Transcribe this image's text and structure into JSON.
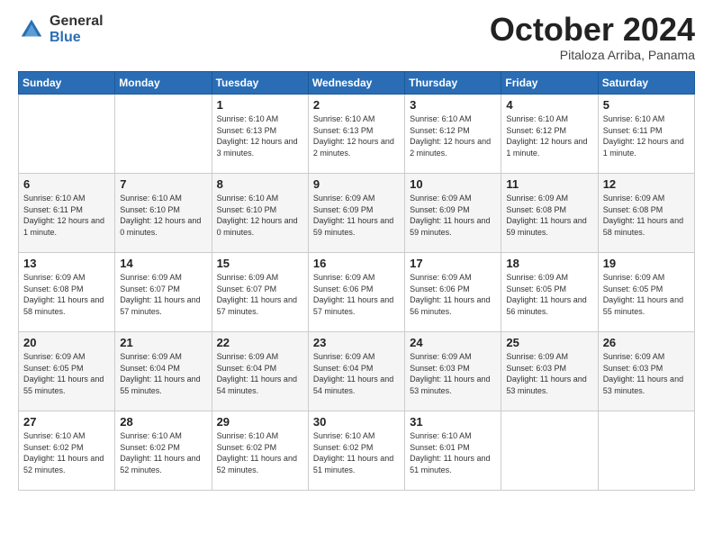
{
  "logo": {
    "general": "General",
    "blue": "Blue"
  },
  "title": "October 2024",
  "subtitle": "Pitaloza Arriba, Panama",
  "weekdays": [
    "Sunday",
    "Monday",
    "Tuesday",
    "Wednesday",
    "Thursday",
    "Friday",
    "Saturday"
  ],
  "weeks": [
    [
      {
        "day": "",
        "info": ""
      },
      {
        "day": "",
        "info": ""
      },
      {
        "day": "1",
        "info": "Sunrise: 6:10 AM\nSunset: 6:13 PM\nDaylight: 12 hours and 3 minutes."
      },
      {
        "day": "2",
        "info": "Sunrise: 6:10 AM\nSunset: 6:13 PM\nDaylight: 12 hours and 2 minutes."
      },
      {
        "day": "3",
        "info": "Sunrise: 6:10 AM\nSunset: 6:12 PM\nDaylight: 12 hours and 2 minutes."
      },
      {
        "day": "4",
        "info": "Sunrise: 6:10 AM\nSunset: 6:12 PM\nDaylight: 12 hours and 1 minute."
      },
      {
        "day": "5",
        "info": "Sunrise: 6:10 AM\nSunset: 6:11 PM\nDaylight: 12 hours and 1 minute."
      }
    ],
    [
      {
        "day": "6",
        "info": "Sunrise: 6:10 AM\nSunset: 6:11 PM\nDaylight: 12 hours and 1 minute."
      },
      {
        "day": "7",
        "info": "Sunrise: 6:10 AM\nSunset: 6:10 PM\nDaylight: 12 hours and 0 minutes."
      },
      {
        "day": "8",
        "info": "Sunrise: 6:10 AM\nSunset: 6:10 PM\nDaylight: 12 hours and 0 minutes."
      },
      {
        "day": "9",
        "info": "Sunrise: 6:09 AM\nSunset: 6:09 PM\nDaylight: 11 hours and 59 minutes."
      },
      {
        "day": "10",
        "info": "Sunrise: 6:09 AM\nSunset: 6:09 PM\nDaylight: 11 hours and 59 minutes."
      },
      {
        "day": "11",
        "info": "Sunrise: 6:09 AM\nSunset: 6:08 PM\nDaylight: 11 hours and 59 minutes."
      },
      {
        "day": "12",
        "info": "Sunrise: 6:09 AM\nSunset: 6:08 PM\nDaylight: 11 hours and 58 minutes."
      }
    ],
    [
      {
        "day": "13",
        "info": "Sunrise: 6:09 AM\nSunset: 6:08 PM\nDaylight: 11 hours and 58 minutes."
      },
      {
        "day": "14",
        "info": "Sunrise: 6:09 AM\nSunset: 6:07 PM\nDaylight: 11 hours and 57 minutes."
      },
      {
        "day": "15",
        "info": "Sunrise: 6:09 AM\nSunset: 6:07 PM\nDaylight: 11 hours and 57 minutes."
      },
      {
        "day": "16",
        "info": "Sunrise: 6:09 AM\nSunset: 6:06 PM\nDaylight: 11 hours and 57 minutes."
      },
      {
        "day": "17",
        "info": "Sunrise: 6:09 AM\nSunset: 6:06 PM\nDaylight: 11 hours and 56 minutes."
      },
      {
        "day": "18",
        "info": "Sunrise: 6:09 AM\nSunset: 6:05 PM\nDaylight: 11 hours and 56 minutes."
      },
      {
        "day": "19",
        "info": "Sunrise: 6:09 AM\nSunset: 6:05 PM\nDaylight: 11 hours and 55 minutes."
      }
    ],
    [
      {
        "day": "20",
        "info": "Sunrise: 6:09 AM\nSunset: 6:05 PM\nDaylight: 11 hours and 55 minutes."
      },
      {
        "day": "21",
        "info": "Sunrise: 6:09 AM\nSunset: 6:04 PM\nDaylight: 11 hours and 55 minutes."
      },
      {
        "day": "22",
        "info": "Sunrise: 6:09 AM\nSunset: 6:04 PM\nDaylight: 11 hours and 54 minutes."
      },
      {
        "day": "23",
        "info": "Sunrise: 6:09 AM\nSunset: 6:04 PM\nDaylight: 11 hours and 54 minutes."
      },
      {
        "day": "24",
        "info": "Sunrise: 6:09 AM\nSunset: 6:03 PM\nDaylight: 11 hours and 53 minutes."
      },
      {
        "day": "25",
        "info": "Sunrise: 6:09 AM\nSunset: 6:03 PM\nDaylight: 11 hours and 53 minutes."
      },
      {
        "day": "26",
        "info": "Sunrise: 6:09 AM\nSunset: 6:03 PM\nDaylight: 11 hours and 53 minutes."
      }
    ],
    [
      {
        "day": "27",
        "info": "Sunrise: 6:10 AM\nSunset: 6:02 PM\nDaylight: 11 hours and 52 minutes."
      },
      {
        "day": "28",
        "info": "Sunrise: 6:10 AM\nSunset: 6:02 PM\nDaylight: 11 hours and 52 minutes."
      },
      {
        "day": "29",
        "info": "Sunrise: 6:10 AM\nSunset: 6:02 PM\nDaylight: 11 hours and 52 minutes."
      },
      {
        "day": "30",
        "info": "Sunrise: 6:10 AM\nSunset: 6:02 PM\nDaylight: 11 hours and 51 minutes."
      },
      {
        "day": "31",
        "info": "Sunrise: 6:10 AM\nSunset: 6:01 PM\nDaylight: 11 hours and 51 minutes."
      },
      {
        "day": "",
        "info": ""
      },
      {
        "day": "",
        "info": ""
      }
    ]
  ]
}
